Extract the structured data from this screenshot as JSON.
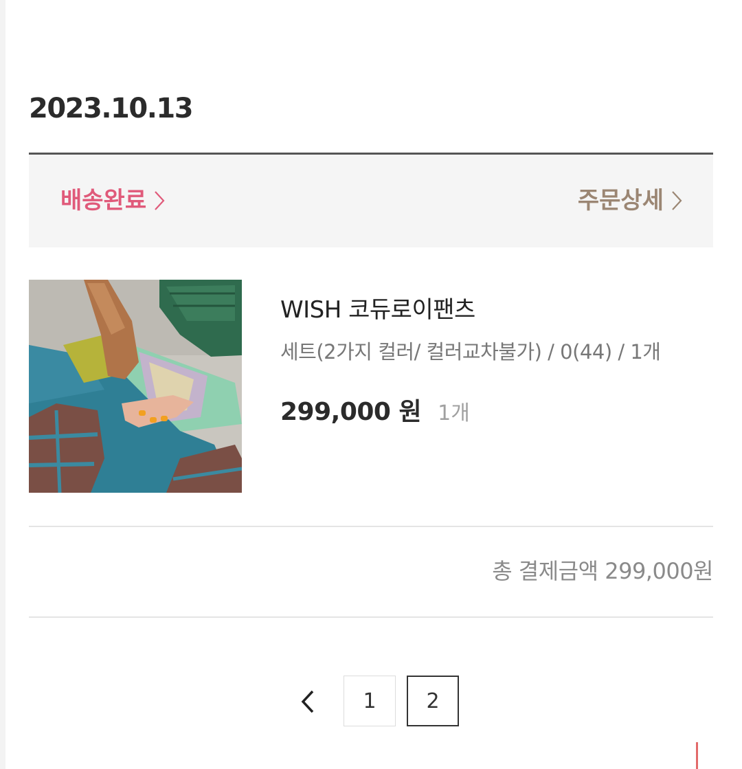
{
  "order": {
    "date": "2023.10.13",
    "status_label": "배송완료",
    "detail_label": "주문상세",
    "product": {
      "name": "WISH 코듀로이팬츠",
      "option": "세트(2가지 컬러/ 컬러교차불가) / 0(44) / 1개",
      "price": "299,000 원",
      "quantity": "1개"
    },
    "total_label": "총 결제금액 299,000원"
  },
  "pagination": {
    "prev_icon": "chevron-left-icon",
    "pages": [
      "1",
      "2"
    ],
    "current_page": "2"
  },
  "colors": {
    "status": "#e05a7a",
    "detail": "#9b8673",
    "status_bar_bg": "#f5f5f5"
  }
}
